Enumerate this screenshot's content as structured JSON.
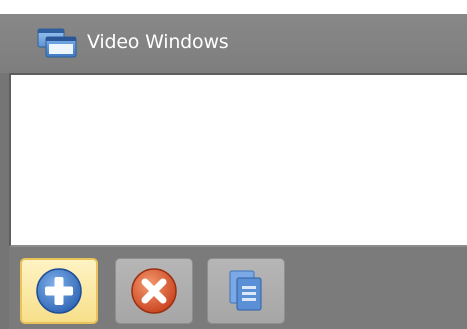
{
  "panel": {
    "title": "Video Windows",
    "title_icon": "video-windows-icon"
  },
  "toolbar": {
    "buttons": [
      {
        "name": "add-button",
        "icon": "plus-circle-icon",
        "state": "highlighted"
      },
      {
        "name": "remove-button",
        "icon": "x-circle-icon",
        "state": "normal"
      },
      {
        "name": "list-button",
        "icon": "documents-icon",
        "state": "normal"
      }
    ]
  },
  "colors": {
    "panel_bg": "#7b7b7b",
    "content_bg": "#ffffff",
    "highlight": "#f7df8a",
    "add_icon": "#3a78c8",
    "remove_icon": "#d9542a",
    "list_icon": "#5b8fd6"
  }
}
